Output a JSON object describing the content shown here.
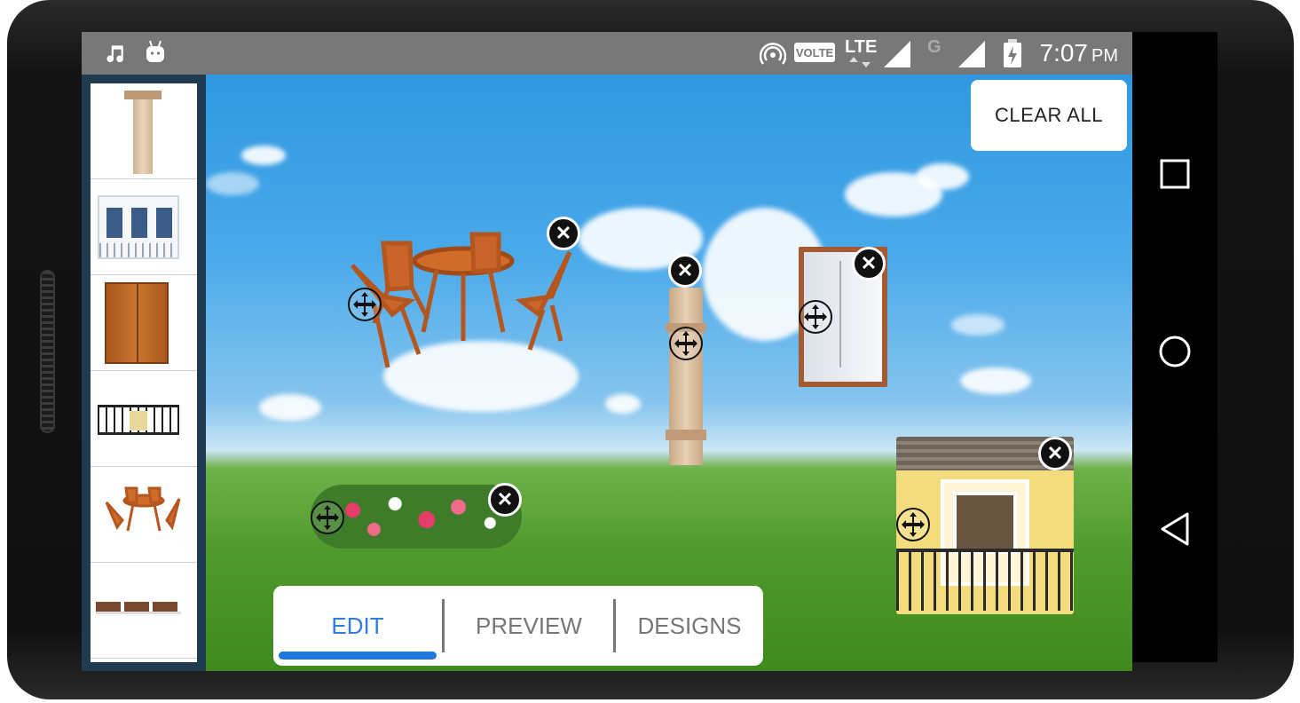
{
  "status_bar": {
    "left_icons": [
      "music-note-icon",
      "android-icon"
    ],
    "right_icons": [
      "hotspot-icon",
      "volte-icon",
      "lte-icon",
      "signal-icon",
      "g-network-icon",
      "signal-icon",
      "battery-charging-icon"
    ],
    "volte_label": "VOLTE",
    "lte_label": "LTE",
    "g_label": "G",
    "time": "7:07",
    "ampm": "PM"
  },
  "toolbar": {
    "clear_all_label": "CLEAR ALL"
  },
  "sidebar": {
    "items": [
      {
        "name": "pillar-thumbnail"
      },
      {
        "name": "window-balcony-thumbnail"
      },
      {
        "name": "wooden-door-thumbnail"
      },
      {
        "name": "railing-thumbnail"
      },
      {
        "name": "patio-furniture-thumbnail"
      },
      {
        "name": "wall-trim-thumbnail"
      }
    ]
  },
  "canvas": {
    "objects": [
      {
        "name": "patio-furniture"
      },
      {
        "name": "wooden-pillar"
      },
      {
        "name": "glass-door"
      },
      {
        "name": "flower-bed"
      },
      {
        "name": "yellow-balcony-window"
      }
    ],
    "close_glyph": "✕"
  },
  "tabs": {
    "items": [
      {
        "label": "EDIT",
        "active": true
      },
      {
        "label": "PREVIEW",
        "active": false
      },
      {
        "label": "DESIGNS",
        "active": false
      }
    ]
  },
  "navigation": {
    "buttons": [
      "recent-apps-icon",
      "home-icon",
      "back-icon"
    ]
  },
  "colors": {
    "accent": "#1e78e0",
    "status_bar": "#787878",
    "sidebar": "#1e3b4f"
  }
}
